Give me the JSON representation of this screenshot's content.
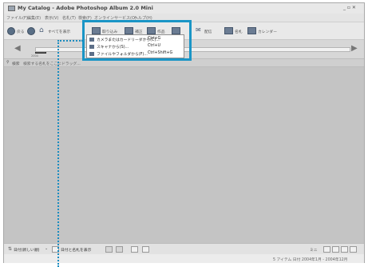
{
  "window": {
    "title": "My Catalog - Adobe Photoshop Album 2.0 Mini",
    "controls": "_ ▫ ✕"
  },
  "menubar": {
    "items": [
      "ファイル(F)",
      "編集(E)",
      "表示(V)",
      "名札(T)",
      "検索(F)",
      "オンラインサービス(O)",
      "ヘルプ(H)"
    ]
  },
  "toolbar": {
    "back_label": "戻る",
    "show_all_label": "すべてを表示",
    "import_label": "取り込み",
    "edit_label": "補正",
    "create_label": "作品",
    "share_label": "配信",
    "tags_label": "名札",
    "calendar_label": "カレンダー"
  },
  "import_menu": {
    "items": [
      {
        "label": "カメラまたはカードリーダから(C)...",
        "shortcut": "Ctrl+G"
      },
      {
        "label": "スキャナから(S)...",
        "shortcut": "Ctrl+U"
      },
      {
        "label": "ファイルやフォルダから(F)...",
        "shortcut": "Ctrl+Shift+G"
      }
    ]
  },
  "timeline": {
    "year_label": "2004"
  },
  "searchbar": {
    "label": "検索",
    "hint": "検索する名札をここにドラッグ..."
  },
  "bottombar": {
    "sort_label": "日付(新しい順)",
    "show_tags_label": "日付と名札を表示",
    "size_label": "ミニ"
  },
  "statusbar": {
    "text": "5 アイテム 日付 2004年1月 - 2004年12月"
  },
  "colors": {
    "highlight": "#1a95c6",
    "content_bg": "#c4c4c4"
  }
}
